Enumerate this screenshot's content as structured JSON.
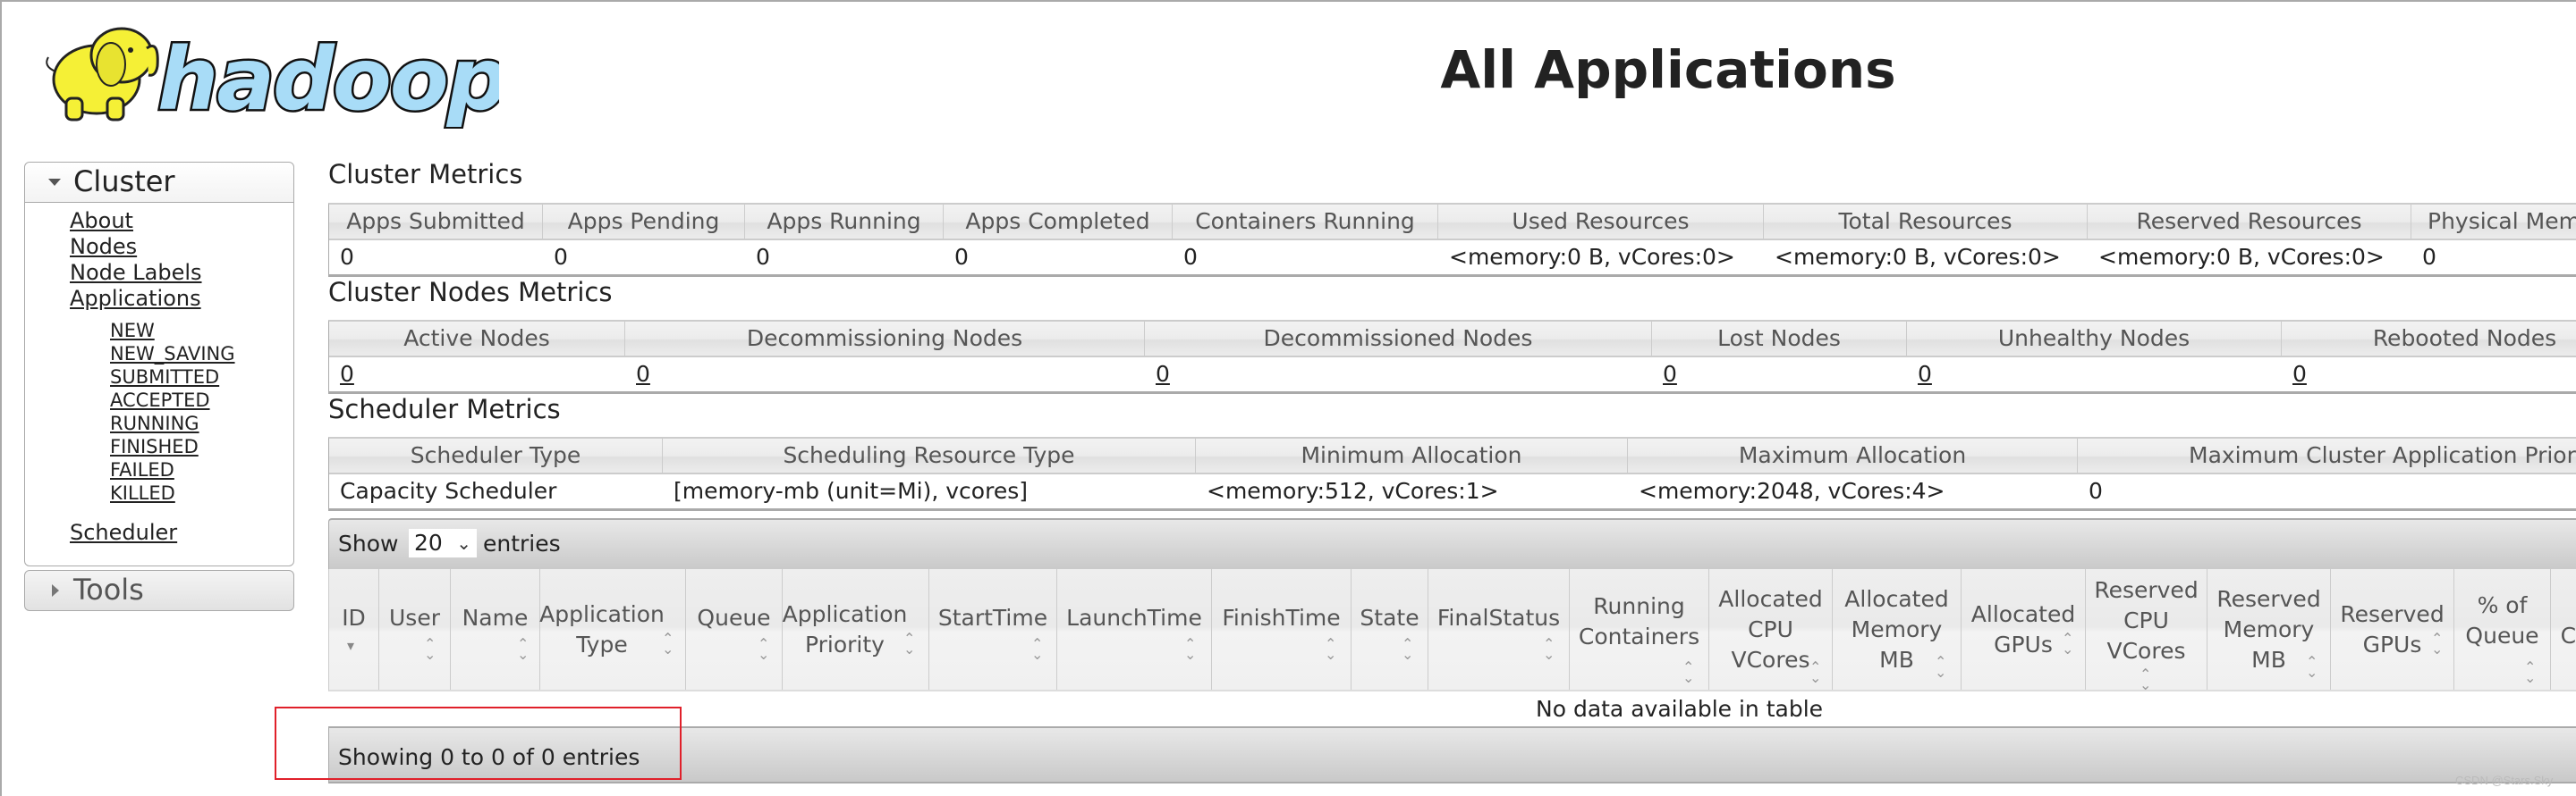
{
  "logo": {
    "text": "hadoop",
    "icon": "hadoop-elephant-logo"
  },
  "header": {
    "title": "All Applications"
  },
  "sidebar": {
    "cluster": {
      "label": "Cluster",
      "links": [
        "About",
        "Nodes",
        "Node Labels",
        "Applications"
      ],
      "app_states": [
        "NEW",
        "NEW_SAVING",
        "SUBMITTED",
        "ACCEPTED",
        "RUNNING",
        "FINISHED",
        "FAILED",
        "KILLED"
      ],
      "scheduler": "Scheduler"
    },
    "tools": {
      "label": "Tools"
    }
  },
  "cluster_metrics": {
    "title": "Cluster Metrics",
    "headers": [
      "Apps Submitted",
      "Apps Pending",
      "Apps Running",
      "Apps Completed",
      "Containers Running",
      "Used Resources",
      "Total Resources",
      "Reserved Resources",
      "Physical Mem"
    ],
    "values": [
      "0",
      "0",
      "0",
      "0",
      "0",
      "<memory:0 B, vCores:0>",
      "<memory:0 B, vCores:0>",
      "<memory:0 B, vCores:0>",
      "0"
    ]
  },
  "node_metrics": {
    "title": "Cluster Nodes Metrics",
    "headers": [
      "Active Nodes",
      "Decommissioning Nodes",
      "Decommissioned Nodes",
      "Lost Nodes",
      "Unhealthy Nodes",
      "Rebooted Nodes"
    ],
    "values": [
      "0",
      "0",
      "0",
      "0",
      "0",
      "0"
    ]
  },
  "scheduler_metrics": {
    "title": "Scheduler Metrics",
    "headers": [
      "Scheduler Type",
      "Scheduling Resource Type",
      "Minimum Allocation",
      "Maximum Allocation",
      "Maximum Cluster Application Priority"
    ],
    "values": [
      "Capacity Scheduler",
      "[memory-mb (unit=Mi), vcores]",
      "<memory:512, vCores:1>",
      "<memory:2048, vCores:4>",
      "0"
    ]
  },
  "apps_table": {
    "show_label": "Show",
    "page_size": "20",
    "entries_label": "entries",
    "columns": [
      "ID",
      "User",
      "Name",
      "Application Type",
      "Queue",
      "Application Priority",
      "StartTime",
      "LaunchTime",
      "FinishTime",
      "State",
      "FinalStatus",
      "Running Containers",
      "Allocated CPU VCores",
      "Allocated Memory MB",
      "Allocated GPUs",
      "Reserved CPU VCores",
      "Reserved Memory MB",
      "Reserved GPUs",
      "% of Queue",
      "% of Cluster"
    ],
    "empty_message": "No data available in table",
    "info": "Showing 0 to 0 of 0 entries"
  },
  "highlight_color": "#e0202a",
  "watermark": "CSDN @Stars.Sky"
}
